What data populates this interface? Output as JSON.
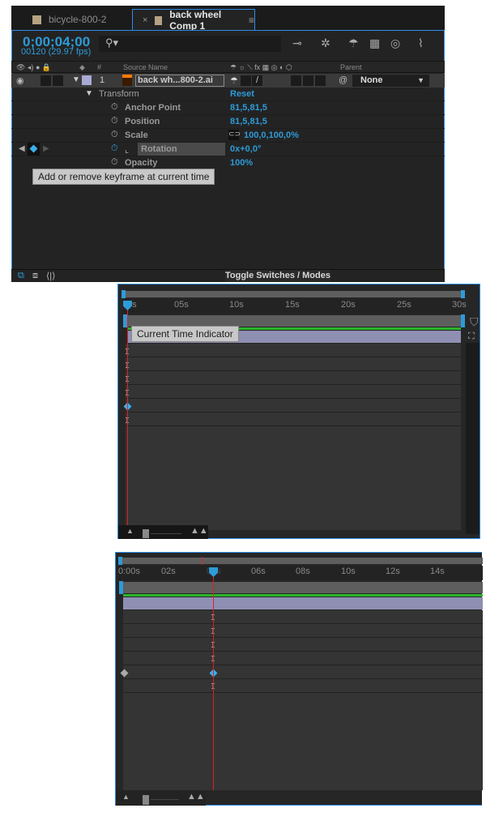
{
  "tabs": [
    {
      "label": "bicycle-800-2",
      "swatch": "#b5a282",
      "active": false
    },
    {
      "label": "back wheel Comp 1",
      "swatch": "#b5a282",
      "active": true,
      "close": "×",
      "menu": "≡"
    }
  ],
  "timecode": "0;00;04;00",
  "frame_info": "00120 (29.97 fps)",
  "search": {
    "placeholder": "",
    "icon": "search-icon"
  },
  "toolbar_icons": [
    "comp-flowchart-icon",
    "draft-3d-icon",
    "shy-layers-icon",
    "frame-blending-icon",
    "motion-blur-icon",
    "graph-editor-icon"
  ],
  "column_headers": {
    "number": "#",
    "source_name": "Source Name",
    "parent": "Parent"
  },
  "layer": {
    "index": "1",
    "name": "back wh...800-2.ai",
    "label_color": "#a9a9d6",
    "parent": "None"
  },
  "transform": {
    "label": "Transform",
    "reset": "Reset",
    "properties": [
      {
        "name": "Anchor Point",
        "value": "81,5,81,5",
        "keyframed": false
      },
      {
        "name": "Position",
        "value": "81,5,81,5",
        "keyframed": false
      },
      {
        "name": "Scale",
        "value": "100,0,100,0%",
        "keyframed": false,
        "linked": true
      },
      {
        "name": "Rotation",
        "value": "0x+0,0°",
        "keyframed": true,
        "selected": true
      },
      {
        "name": "Opacity",
        "value": "100%",
        "keyframed": false
      }
    ]
  },
  "tooltip_keyframe": "Add or remove keyframe at current time",
  "toggle_label": "Toggle Switches / Modes",
  "timeline1": {
    "ticks": [
      "0s",
      "05s",
      "10s",
      "15s",
      "20s",
      "25s",
      "30s"
    ],
    "tooltip": "Current Time Indicator",
    "cti_seconds": 0
  },
  "timeline2": {
    "ticks": [
      "0:00s",
      "02s",
      "04s",
      "06s",
      "08s",
      "10s",
      "12s",
      "14s"
    ],
    "cti_seconds": 4
  }
}
